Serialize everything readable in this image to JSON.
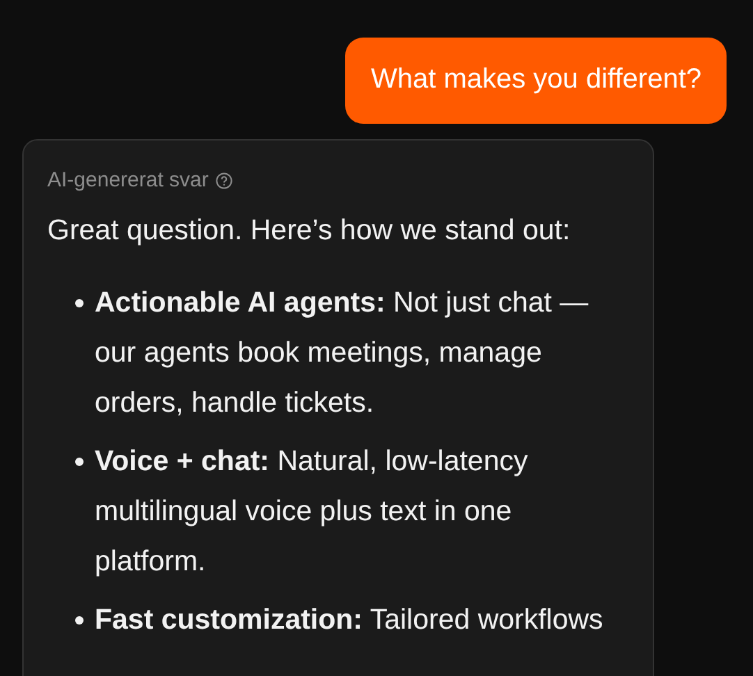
{
  "user_message": {
    "text": "What makes you different?"
  },
  "reply": {
    "label": "AI-genererat svar",
    "intro": "Great question. Here’s how we stand out:",
    "points": [
      {
        "title": "Actionable AI agents:",
        "text": "Not just chat — our agents book meetings, manage orders, handle tickets."
      },
      {
        "title": "Voice + chat:",
        "text": "Natural, low-latency multilingual voice plus text in one platform."
      },
      {
        "title": "Fast customization:",
        "text": "Tailored workflows"
      }
    ]
  }
}
